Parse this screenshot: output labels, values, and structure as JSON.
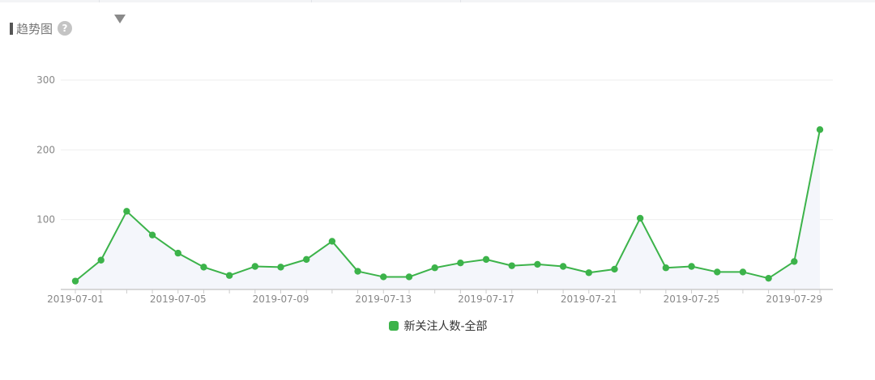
{
  "header": {
    "title": "趋势图",
    "help_glyph": "?"
  },
  "icons": {
    "help": "help-icon",
    "dropdown": "caret-down-icon"
  },
  "colors": {
    "series": "#3cb34a",
    "area_fill": "#f4f6fb",
    "grid": "#eeeeee",
    "axis": "#cccccc",
    "tick_text": "#888888"
  },
  "chart_data": {
    "type": "line",
    "xlabel": "",
    "ylabel": "",
    "grid": true,
    "legend_position": "bottom",
    "ylim": [
      0,
      300
    ],
    "yticks": [
      100,
      200,
      300
    ],
    "xticks": [
      "2019-07-01",
      "2019-07-05",
      "2019-07-09",
      "2019-07-13",
      "2019-07-17",
      "2019-07-21",
      "2019-07-25",
      "2019-07-29"
    ],
    "x": [
      "2019-07-01",
      "2019-07-02",
      "2019-07-03",
      "2019-07-04",
      "2019-07-05",
      "2019-07-06",
      "2019-07-07",
      "2019-07-08",
      "2019-07-09",
      "2019-07-10",
      "2019-07-11",
      "2019-07-12",
      "2019-07-13",
      "2019-07-14",
      "2019-07-15",
      "2019-07-16",
      "2019-07-17",
      "2019-07-18",
      "2019-07-19",
      "2019-07-20",
      "2019-07-21",
      "2019-07-22",
      "2019-07-23",
      "2019-07-24",
      "2019-07-25",
      "2019-07-26",
      "2019-07-27",
      "2019-07-28",
      "2019-07-29",
      "2019-07-30"
    ],
    "series": [
      {
        "name": "新关注人数-全部",
        "values": [
          12,
          42,
          112,
          78,
          52,
          32,
          20,
          33,
          32,
          43,
          69,
          26,
          18,
          18,
          31,
          38,
          43,
          34,
          36,
          33,
          24,
          29,
          102,
          31,
          33,
          25,
          25,
          16,
          40,
          229
        ]
      }
    ]
  }
}
